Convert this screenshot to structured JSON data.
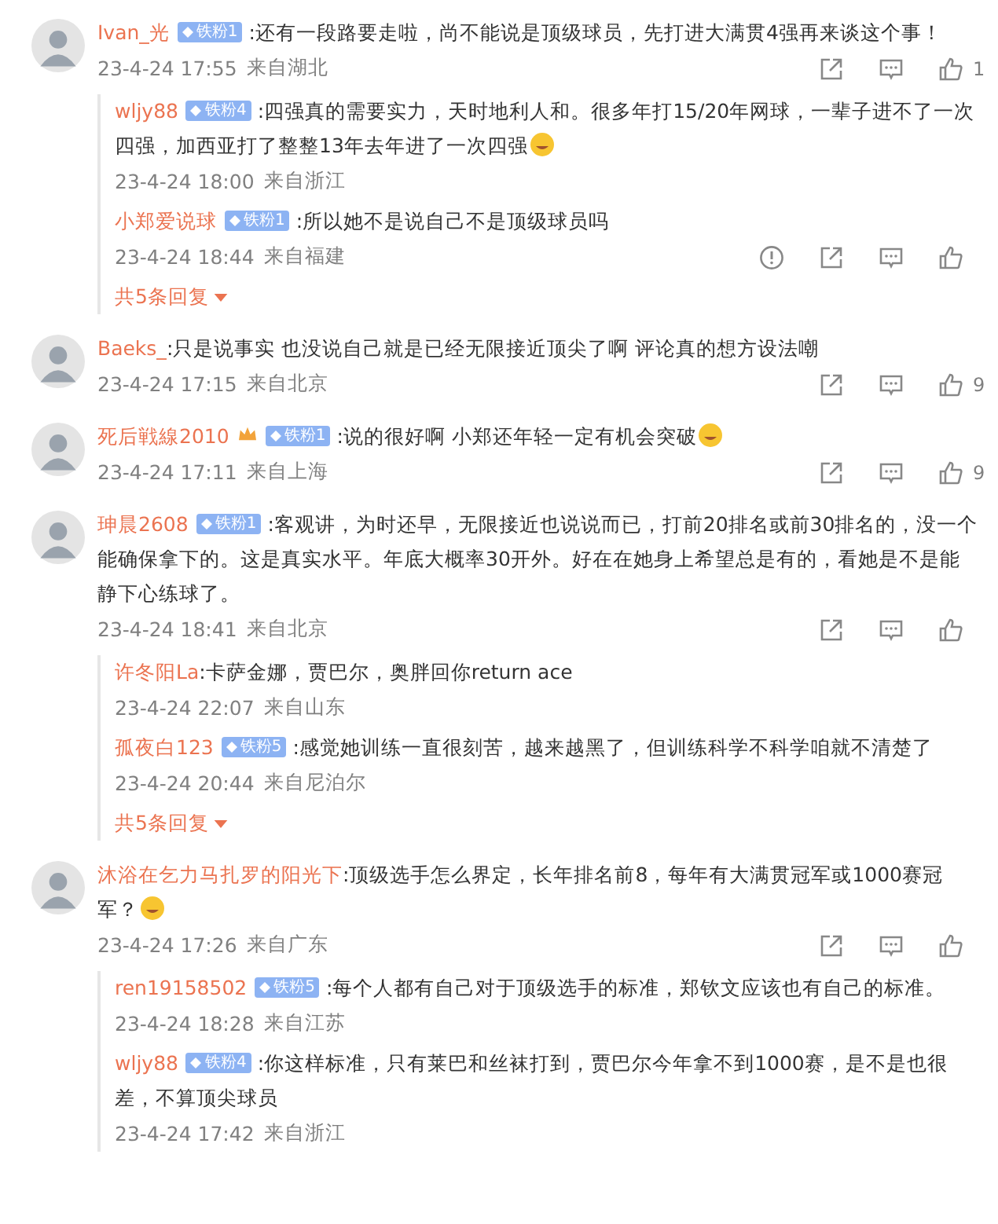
{
  "comments": [
    {
      "author": "Ivan_光",
      "badge": "铁粉1",
      "text_lines": [
        ":还有一段路要走啦，尚不能说是顶级球员，先打进大满贯4强再来谈这个事！"
      ],
      "time": "23-4-24 17:55",
      "location": "来自湖北",
      "likes": "1",
      "replies": [
        {
          "author": "wljy88",
          "badge": "铁粉4",
          "text_lines": [
            ":四强真的需要实力，天时地利人和。很多年打15/20年网球，一辈子进不了一次",
            "四强，加西亚打了整整13年去年进了一次四强"
          ],
          "emoji_end": true,
          "time": "23-4-24 18:00",
          "location": "来自浙江"
        },
        {
          "author": "小郑爱说球",
          "badge": "铁粉1",
          "text_lines": [
            ":所以她不是说自己不是顶级球员吗"
          ],
          "time": "23-4-24 18:44",
          "location": "来自福建",
          "actions": true
        }
      ],
      "more_replies": "共5条回复"
    },
    {
      "author": "Baeks_",
      "text_lines": [
        ":只是说事实 也没说自己就是已经无限接近顶尖了啊 评论真的想方设法嘲"
      ],
      "time": "23-4-24 17:15",
      "location": "来自北京",
      "likes": "9"
    },
    {
      "author": "死后戦線2010",
      "badge": "铁粉1",
      "crown": true,
      "text_lines": [
        ":说的很好啊 小郑还年轻一定有机会突破"
      ],
      "emoji_end": true,
      "time": "23-4-24 17:11",
      "location": "来自上海",
      "likes": "9"
    },
    {
      "author": "珅晨2608",
      "badge": "铁粉1",
      "text_lines": [
        ":客观讲，为时还早，无限接近也说说而已，打前20排名或前30排名的，没一个",
        "能确保拿下的。这是真实水平。年底大概率30开外。好在在她身上希望总是有的，看她是不是能",
        "静下心练球了。"
      ],
      "time": "23-4-24 18:41",
      "location": "来自北京",
      "replies": [
        {
          "author": "许冬阳La",
          "text_lines": [
            ":卡萨金娜，贾巴尔，奥胖回你return ace"
          ],
          "time": "23-4-24 22:07",
          "location": "来自山东"
        },
        {
          "author": "孤夜白123",
          "badge": "铁粉5",
          "text_lines": [
            ":感觉她训练一直很刻苦，越来越黑了，但训练科学不科学咱就不清楚了"
          ],
          "time": "23-4-24 20:44",
          "location": "来自尼泊尔"
        }
      ],
      "more_replies": "共5条回复"
    },
    {
      "author": "沐浴在乞力马扎罗的阳光下",
      "text_lines": [
        ":顶级选手怎么界定，长年排名前8，每年有大满贯冠军或1000赛冠",
        "军？"
      ],
      "emoji_end": true,
      "time": "23-4-24 17:26",
      "location": "来自广东",
      "replies": [
        {
          "author": "ren19158502",
          "badge": "铁粉5",
          "text_lines": [
            ":每个人都有自己对于顶级选手的标准，郑钦文应该也有自己的标准。"
          ],
          "time": "23-4-24 18:28",
          "location": "来自江苏"
        },
        {
          "author": "wljy88",
          "badge": "铁粉4",
          "text_lines": [
            ":你这样标准，只有莱巴和丝袜打到，贾巴尔今年拿不到1000赛，是不是也很",
            "差，不算顶尖球员"
          ],
          "time": "23-4-24 17:42",
          "location": "来自浙江"
        }
      ]
    }
  ]
}
